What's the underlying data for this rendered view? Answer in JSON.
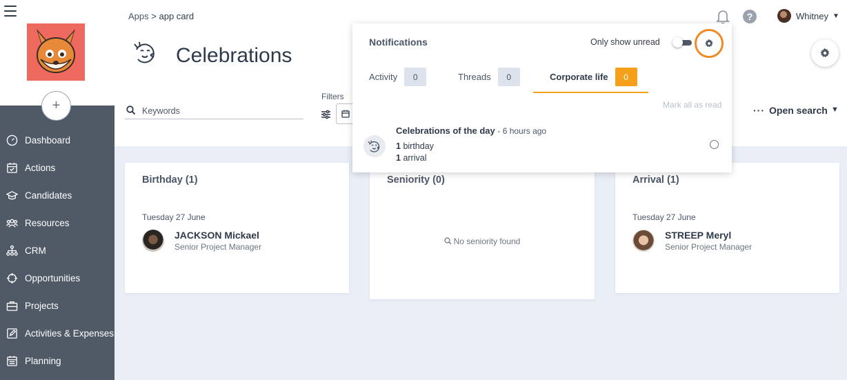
{
  "sidebar": {
    "add_label": "+",
    "items": [
      {
        "label": "Dashboard",
        "icon": "gauge-icon"
      },
      {
        "label": "Actions",
        "icon": "calendar-check-icon"
      },
      {
        "label": "Candidates",
        "icon": "graduation-cap-icon"
      },
      {
        "label": "Resources",
        "icon": "users-icon"
      },
      {
        "label": "CRM",
        "icon": "org-chart-icon"
      },
      {
        "label": "Opportunities",
        "icon": "crosshair-icon"
      },
      {
        "label": "Projects",
        "icon": "briefcase-icon"
      },
      {
        "label": "Activities & Expenses",
        "icon": "edit-icon"
      },
      {
        "label": "Planning",
        "icon": "calendar-icon"
      }
    ]
  },
  "header": {
    "breadcrumb_root": "Apps",
    "breadcrumb_sep": ">",
    "breadcrumb_current": "app card",
    "title": "Celebrations",
    "search_placeholder": "Keywords",
    "filters_label": "Filters",
    "open_search_dots": "···",
    "open_search_label": "Open search",
    "user_name": "Whitney",
    "help_label": "?"
  },
  "notifications": {
    "title": "Notifications",
    "only_unread_label": "Only show unread",
    "tabs": [
      {
        "label": "Activity",
        "count": "0"
      },
      {
        "label": "Threads",
        "count": "0"
      },
      {
        "label": "Corporate life",
        "count": "0"
      }
    ],
    "mark_all": "Mark all as read",
    "item": {
      "title": "Celebrations of the day",
      "time": "- 6 hours ago",
      "line1_count": "1",
      "line1_text": "birthday",
      "line2_count": "1",
      "line2_text": "arrival"
    }
  },
  "cards": [
    {
      "title": "Birthday (1)",
      "date": "Tuesday 27 June",
      "name": "JACKSON Mickael",
      "role": "Senior Project Manager"
    },
    {
      "title": "Seniority (0)",
      "empty": "No seniority found"
    },
    {
      "title": "Arrival (1)",
      "date": "Tuesday 27 June",
      "name": "STREEP Meryl",
      "role": "Senior Project Manager"
    }
  ],
  "colors": {
    "sidebar_bg": "#505a66",
    "accent_orange": "#f5a01a",
    "highlight_ring": "#f08a24",
    "logo_bg": "#ee6a5f"
  }
}
